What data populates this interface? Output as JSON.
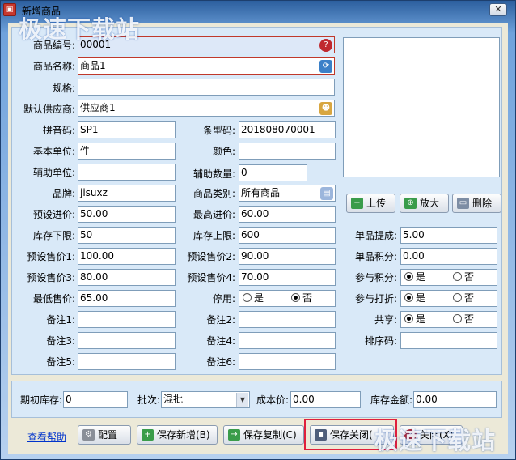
{
  "window": {
    "title": "新增商品",
    "app_icon": "app-logo-icon",
    "close_label": "✕"
  },
  "watermark": {
    "text": "极速下载站"
  },
  "form": {
    "code": {
      "label": "商品编号:",
      "value": "00001"
    },
    "name": {
      "label": "商品名称:",
      "value": "商品1"
    },
    "spec": {
      "label": "规格:",
      "value": ""
    },
    "supplier": {
      "label": "默认供应商:",
      "value": "供应商1"
    },
    "pinyin": {
      "label": "拼音码:",
      "value": "SP1"
    },
    "barcode": {
      "label": "条型码:",
      "value": "201808070001"
    },
    "unit": {
      "label": "基本单位:",
      "value": "件"
    },
    "color": {
      "label": "颜色:",
      "value": ""
    },
    "aux_unit": {
      "label": "辅助单位:",
      "value": ""
    },
    "aux_qty": {
      "label": "辅助数量:",
      "value": "0"
    },
    "brand": {
      "label": "品牌:",
      "value": "jisuxz"
    },
    "category": {
      "label": "商品类别:",
      "value": "所有商品"
    },
    "preset_cost": {
      "label": "预设进价:",
      "value": "50.00"
    },
    "max_cost": {
      "label": "最高进价:",
      "value": "60.00"
    },
    "min_stock": {
      "label": "库存下限:",
      "value": "50"
    },
    "max_stock": {
      "label": "库存上限:",
      "value": "600"
    },
    "price1": {
      "label": "预设售价1:",
      "value": "100.00"
    },
    "price2": {
      "label": "预设售价2:",
      "value": "90.00"
    },
    "price3": {
      "label": "预设售价3:",
      "value": "80.00"
    },
    "price4": {
      "label": "预设售价4:",
      "value": "70.00"
    },
    "min_price": {
      "label": "最低售价:",
      "value": "65.00"
    },
    "disabled": {
      "label": "停用:",
      "yes": "是",
      "no": "否",
      "selected": "否"
    },
    "note1": {
      "label": "备注1:",
      "value": ""
    },
    "note2": {
      "label": "备注2:",
      "value": ""
    },
    "note3": {
      "label": "备注3:",
      "value": ""
    },
    "note4": {
      "label": "备注4:",
      "value": ""
    },
    "note5": {
      "label": "备注5:",
      "value": ""
    },
    "note6": {
      "label": "备注6:",
      "value": ""
    },
    "commission": {
      "label": "单品提成:",
      "value": "5.00"
    },
    "points": {
      "label": "单品积分:",
      "value": "0.00"
    },
    "join_points": {
      "label": "参与积分:",
      "yes": "是",
      "no": "否",
      "selected": "是"
    },
    "join_discount": {
      "label": "参与打折:",
      "yes": "是",
      "no": "否",
      "selected": "是"
    },
    "shared": {
      "label": "共享:",
      "yes": "是",
      "no": "否",
      "selected": "是"
    },
    "sort_code": {
      "label": "排序码:",
      "value": ""
    }
  },
  "image_buttons": {
    "upload": "上传",
    "zoom": "放大",
    "delete": "删除"
  },
  "bottom": {
    "init_stock": {
      "label": "期初库存:",
      "value": "0"
    },
    "batch": {
      "label": "批次:",
      "value": "混批"
    },
    "cost": {
      "label": "成本价:",
      "value": "0.00"
    },
    "amount": {
      "label": "库存金额:",
      "value": "0.00"
    }
  },
  "footer": {
    "help": "查看帮助",
    "config": "配置",
    "save_new": "保存新增(B)",
    "save_copy": "保存复制(C)",
    "save_close": "保存关闭(",
    "close": "关闭(X)"
  },
  "colors": {
    "highlight": "#e0203c",
    "required_border": "#c0392b"
  }
}
